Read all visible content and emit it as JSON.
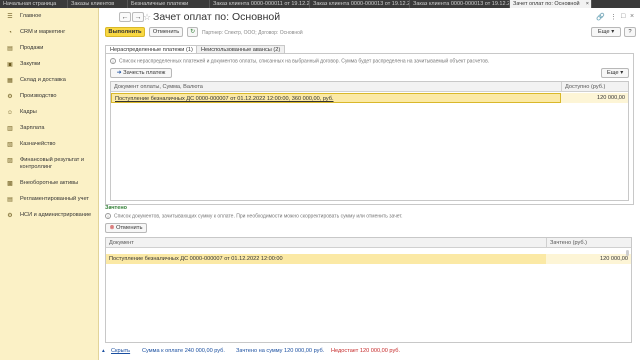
{
  "tabs": [
    {
      "label": "Начальная страница"
    },
    {
      "label": "Заказы клиентов"
    },
    {
      "label": "Безналичные платежи"
    },
    {
      "label": "Заказ клиента 0000-000011 от 19.12.2022 12:04:53"
    },
    {
      "label": "Заказ клиента 0000-000013 от 19.12.2022 12:05:04"
    },
    {
      "label": "Заказ клиента 0000-000013 от 19.12.2022 12:09:04"
    },
    {
      "label": "Зачет оплат по: Основной"
    }
  ],
  "sidebar": {
    "items": [
      {
        "label": "Главное",
        "icon": "☰"
      },
      {
        "label": "CRM и маркетинг",
        "icon": "◔"
      },
      {
        "label": "Продажи",
        "icon": "▤"
      },
      {
        "label": "Закупки",
        "icon": "▣"
      },
      {
        "label": "Склад и доставка",
        "icon": "▦"
      },
      {
        "label": "Производство",
        "icon": "⚙"
      },
      {
        "label": "Кадры",
        "icon": "☺"
      },
      {
        "label": "Зарплата",
        "icon": "▥"
      },
      {
        "label": "Казначейство",
        "icon": "▧"
      },
      {
        "label": "Финансовый результат и контроллинг",
        "icon": "▨"
      },
      {
        "label": "Внеоборотные активы",
        "icon": "▩"
      },
      {
        "label": "Регламентированный учет",
        "icon": "▤"
      },
      {
        "label": "НСИ и администрирование",
        "icon": "⚙"
      }
    ]
  },
  "header": {
    "title": "Зачет оплат по: Основной",
    "more_label": "Еще"
  },
  "toolbar": {
    "execute_label": "Выполнить",
    "cancel_label": "Отменить",
    "partner_text": "Партнер: Спектр, ООО; Договор: Основной"
  },
  "inner_tabs": [
    {
      "label": "Нераспределенные платежи (1)"
    },
    {
      "label": "Неиспользованные авансы (2)"
    }
  ],
  "unallocated": {
    "info": "Список нераспределенных платежей и документов оплаты, списанных на выбранный договор. Сумма будет распределена на зачитываемый объект расчетов.",
    "add_payment_label": "Зачесть платеж",
    "more_label": "Еще",
    "columns": [
      "Документ оплаты, Сумма, Валюта",
      "Доступно (руб.)"
    ],
    "rows": [
      {
        "document": "Поступление безналичных ДС 0000-000007 от 01.12.2022 12:00:00, 360 000,00, руб.",
        "available": "120 000,00"
      }
    ]
  },
  "credited": {
    "section_label": "Зачтено",
    "info": "Список документов, зачитывающих сумму к оплате. При необходимости можно скорректировать сумму или отменить зачет.",
    "cancel_label": "Отменить",
    "columns": [
      "Документ",
      "Зачтено (руб.)"
    ],
    "rows": [
      {
        "document": "Поступление безналичных ДС 0000-000007 от 01.12.2022 12:00:00",
        "amount": "120 000,00"
      }
    ]
  },
  "footer": {
    "hide_label": "Скрыть",
    "sum_to_pay": "Сумма к оплате 240 000,00 руб.",
    "credited_sum": "Зачтено на сумму 120 000,00 руб.",
    "shortage": "Недостает 120 000,00 руб."
  },
  "colors": {
    "accent": "#f9d842",
    "sidebar_bg": "#fbf1c6",
    "selected_row": "#fbe9a5",
    "credited_green": "#2e7d32",
    "link_blue": "#1a4fa0",
    "shortage_red": "#c62828"
  }
}
